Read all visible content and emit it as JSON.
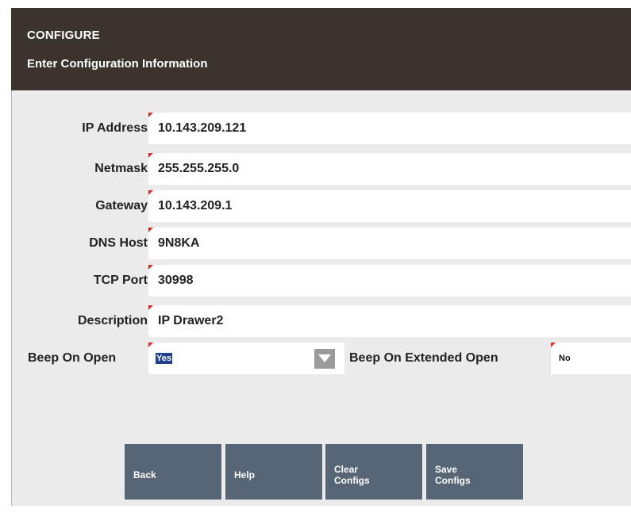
{
  "header": {
    "title": "CONFIGURE",
    "subtitle": "Enter Configuration Information"
  },
  "fields": [
    {
      "label": "IP Address",
      "value": "10.143.209.121"
    },
    {
      "label": "Netmask",
      "value": "255.255.255.0"
    },
    {
      "label": "Gateway",
      "value": "10.143.209.1"
    },
    {
      "label": "DNS Host",
      "value": "9N8KA"
    },
    {
      "label": "TCP Port",
      "value": "30998"
    },
    {
      "label": "Description",
      "value": "IP Drawer2"
    }
  ],
  "beep_on_open": {
    "label": "Beep On Open",
    "selected": "Yes"
  },
  "beep_on_extended_open": {
    "label": "Beep On Extended Open",
    "value": "No"
  },
  "buttons": {
    "back": "Back",
    "help": "Help",
    "clear_configs": "Clear\nConfigs",
    "save_configs": "Save\nConfigs"
  },
  "colors": {
    "header_bg": "#3a342c",
    "panel_bg": "#ebebeb",
    "button_bg": "#566676",
    "required_marker": "#e8261f",
    "selection_bg": "#1f3f8f"
  }
}
